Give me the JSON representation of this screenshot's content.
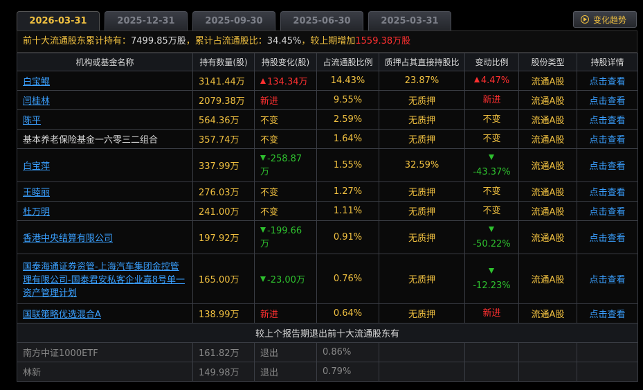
{
  "tabs": [
    "2026-03-31",
    "2025-12-31",
    "2025-09-30",
    "2025-06-30",
    "2025-03-31"
  ],
  "active_tab": 0,
  "trend_button": "变化趋势",
  "summary": {
    "prefix": "前十大流通股东累计持有：",
    "total_hold": "7499.85万股",
    "sep1": "，累计占流通股比：",
    "total_ratio": "34.45%",
    "sep2": "，较上期增加",
    "increase": "1559.38万股"
  },
  "columns": [
    "机构或基金名称",
    "持有数量(股)",
    "持股变化(股)",
    "占流通股比例",
    "质押占其直接持股比",
    "变动比例",
    "股份类型",
    "持股详情"
  ],
  "rows": [
    {
      "name": "白宝鲲",
      "is_link": true,
      "hold": "3141.44万",
      "change": "134.34万",
      "change_dir": "up",
      "ratio": "14.43%",
      "pledge": "23.87%",
      "chg_ratio": "4.47%",
      "chg_dir": "up",
      "type": "流通A股",
      "detail": "点击查看"
    },
    {
      "name": "闫桂林",
      "is_link": true,
      "hold": "2079.38万",
      "change": "新进",
      "change_dir": "new",
      "ratio": "9.55%",
      "pledge": "无质押",
      "chg_ratio": "新进",
      "chg_dir": "new",
      "type": "流通A股",
      "detail": "点击查看"
    },
    {
      "name": "陈平",
      "is_link": true,
      "hold": "564.36万",
      "change": "不变",
      "change_dir": "same",
      "ratio": "2.59%",
      "pledge": "无质押",
      "chg_ratio": "不变",
      "chg_dir": "same",
      "type": "流通A股",
      "detail": "点击查看"
    },
    {
      "name": "基本养老保险基金一六零三二组合",
      "is_link": false,
      "hold": "357.74万",
      "change": "不变",
      "change_dir": "same",
      "ratio": "1.64%",
      "pledge": "无质押",
      "chg_ratio": "不变",
      "chg_dir": "same",
      "type": "流通A股",
      "detail": "点击查看"
    },
    {
      "name": "白宝萍",
      "is_link": true,
      "hold": "337.99万",
      "change": "-258.87万",
      "change_dir": "down",
      "ratio": "1.55%",
      "pledge": "32.59%",
      "chg_ratio": "-43.37%",
      "chg_dir": "down",
      "type": "流通A股",
      "detail": "点击查看"
    },
    {
      "name": "王睦丽",
      "is_link": true,
      "hold": "276.03万",
      "change": "不变",
      "change_dir": "same",
      "ratio": "1.27%",
      "pledge": "无质押",
      "chg_ratio": "不变",
      "chg_dir": "same",
      "type": "流通A股",
      "detail": "点击查看"
    },
    {
      "name": "杜万明",
      "is_link": true,
      "hold": "241.00万",
      "change": "不变",
      "change_dir": "same",
      "ratio": "1.11%",
      "pledge": "无质押",
      "chg_ratio": "不变",
      "chg_dir": "same",
      "type": "流通A股",
      "detail": "点击查看"
    },
    {
      "name": "香港中央结算有限公司",
      "is_link": true,
      "hold": "197.92万",
      "change": "-199.66万",
      "change_dir": "down",
      "ratio": "0.91%",
      "pledge": "无质押",
      "chg_ratio": "-50.22%",
      "chg_dir": "down",
      "type": "流通A股",
      "detail": "点击查看"
    },
    {
      "name": "国泰海通证券资管-上海汽车集团金控管理有限公司-国泰君安私客企业嘉8号单一资产管理计划",
      "is_link": true,
      "hold": "165.00万",
      "change": "-23.00万",
      "change_dir": "down",
      "ratio": "0.76%",
      "pledge": "无质押",
      "chg_ratio": "-12.23%",
      "chg_dir": "down",
      "type": "流通A股",
      "detail": "点击查看"
    },
    {
      "name": "国联策略优选混合A",
      "is_link": true,
      "hold": "138.99万",
      "change": "新进",
      "change_dir": "new",
      "ratio": "0.64%",
      "pledge": "无质押",
      "chg_ratio": "新进",
      "chg_dir": "new",
      "type": "流通A股",
      "detail": "点击查看"
    }
  ],
  "exit_title": "较上个报告期退出前十大流通股东有",
  "exit_rows": [
    {
      "name": "南方中证1000ETF",
      "hold": "161.82万",
      "change": "退出",
      "ratio": "0.86%"
    },
    {
      "name": "林新",
      "hold": "149.98万",
      "change": "退出",
      "ratio": "0.79%"
    }
  ],
  "colors": {
    "accent": "#f0c040",
    "up": "#ff3030",
    "down": "#2ec02e",
    "link": "#3aa0ff"
  }
}
